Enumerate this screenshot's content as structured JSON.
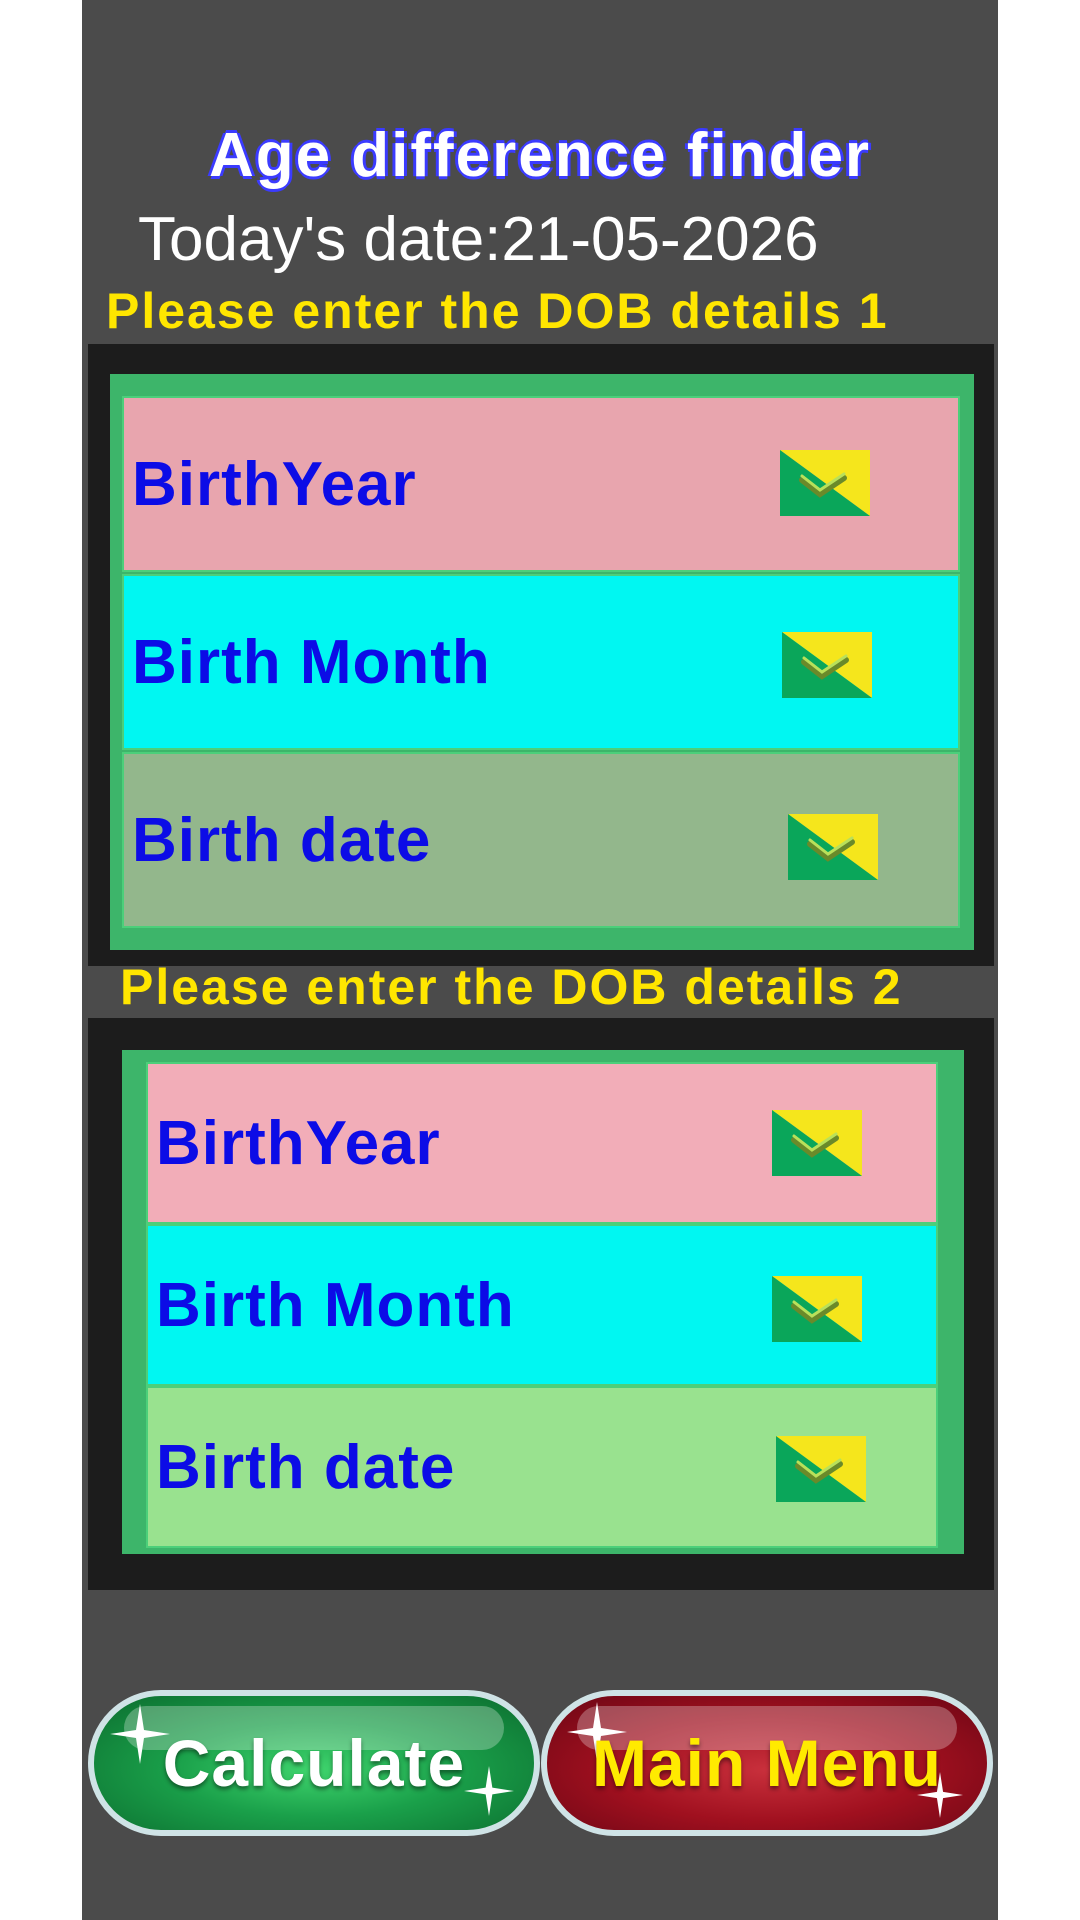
{
  "header": {
    "title": "Age difference finder",
    "today": "Today's date:21-05-2026"
  },
  "section1": {
    "prompt": "Please enter the DOB details 1",
    "rows": [
      {
        "label": "BirthYear",
        "color": "#e8a5ae",
        "icon": "dropdown-icon"
      },
      {
        "label": "Birth Month",
        "color": "#00f7f2",
        "icon": "dropdown-icon"
      },
      {
        "label": "Birth date",
        "color": "#93b78c",
        "icon": "dropdown-icon"
      }
    ]
  },
  "section2": {
    "prompt": "Please enter the DOB details 2",
    "rows": [
      {
        "label": "BirthYear",
        "color": "#f2adb8",
        "icon": "dropdown-icon"
      },
      {
        "label": "Birth Month",
        "color": "#00f7f2",
        "icon": "dropdown-icon"
      },
      {
        "label": "Birth date",
        "color": "#99e28f",
        "icon": "dropdown-icon"
      }
    ]
  },
  "buttons": {
    "calculate": "Calculate",
    "main_menu": "Main Menu"
  },
  "colors": {
    "background": "#4b4b4b",
    "prompt_text": "#ffe600",
    "label_text": "#0c0ce6",
    "panel_green": "#3db56a"
  }
}
